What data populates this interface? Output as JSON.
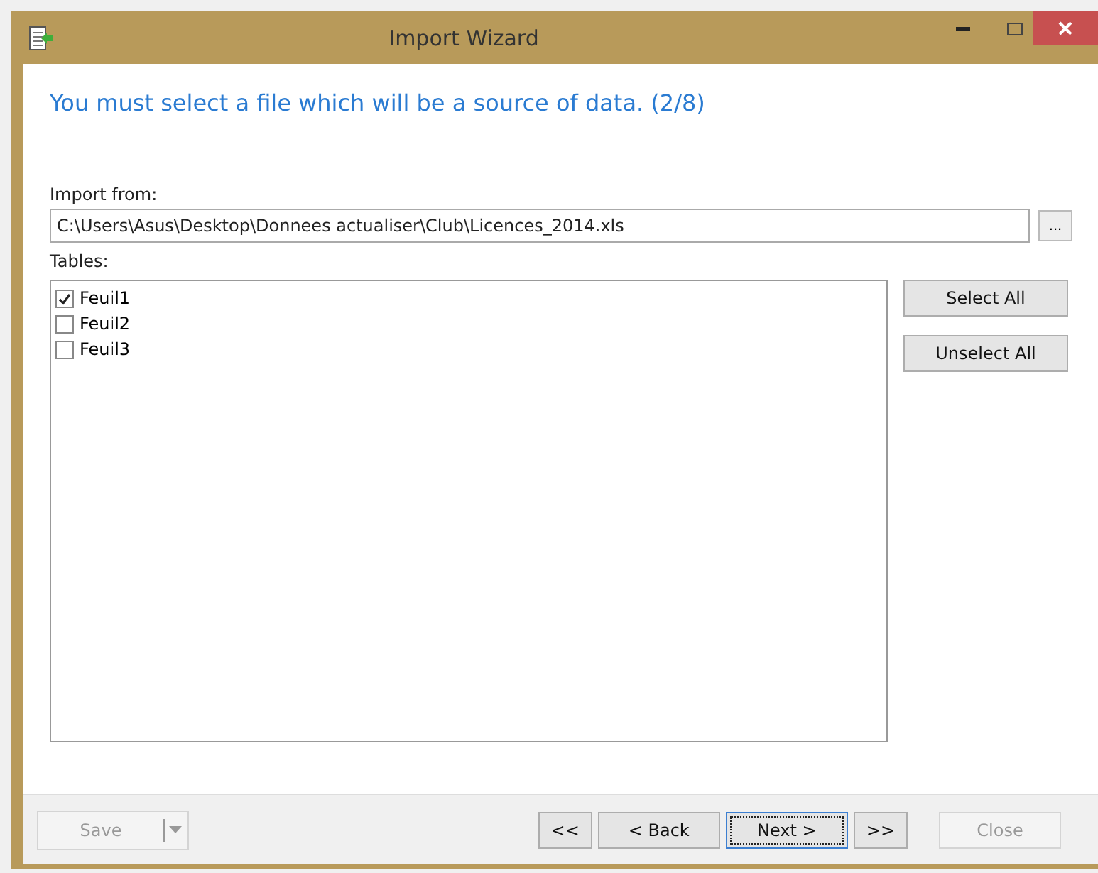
{
  "window": {
    "title": "Import Wizard"
  },
  "heading": "You must select a file which will be a source of data. (2/8)",
  "import_from": {
    "label": "Import from:",
    "value": "C:\\Users\\Asus\\Desktop\\Donnees actualiser\\Club\\Licences_2014.xls",
    "browse": "..."
  },
  "tables": {
    "label": "Tables:",
    "items": [
      {
        "label": "Feuil1",
        "checked": true
      },
      {
        "label": "Feuil2",
        "checked": false
      },
      {
        "label": "Feuil3",
        "checked": false
      }
    ]
  },
  "side_buttons": [
    "Select All",
    "Unselect All"
  ],
  "save": {
    "label": "Save",
    "disabled": true
  },
  "nav_buttons": [
    {
      "label": "<<",
      "disabled": false,
      "focused": false
    },
    {
      "label": "< Back",
      "disabled": false,
      "focused": false
    },
    {
      "label": "Next >",
      "disabled": false,
      "focused": true
    },
    {
      "label": ">>",
      "disabled": false,
      "focused": false
    },
    {
      "label": "Close",
      "disabled": true,
      "focused": false
    }
  ]
}
